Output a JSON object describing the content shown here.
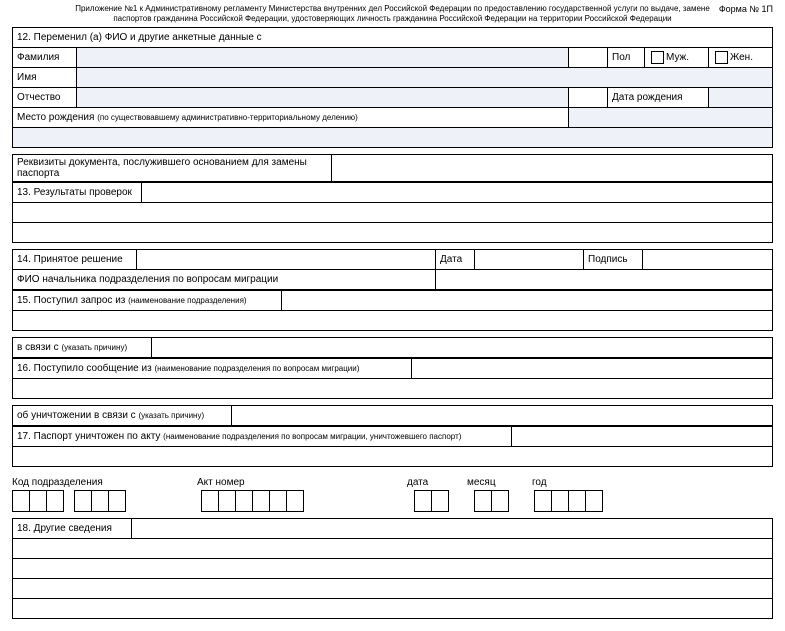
{
  "header": {
    "line1": "Приложение №1 к Административному регламенту Министерства внутренних дел Российской Федерации по предоставлению государственной услуги по выдаче, замене",
    "line2": "паспортов гражданина Российской Федерации, удостоверяющих личность гражданина Российской Федерации на территории Российской Федерации",
    "form_no": "Форма № 1П"
  },
  "s12": {
    "title": "12. Переменил (а) ФИО и другие анкетные данные с",
    "surname": "Фамилия",
    "name": "Имя",
    "patronymic": "Отчество",
    "sex": "Пол",
    "male": "Муж.",
    "female": "Жен.",
    "dob": "Дата рождения",
    "pob": "Место рождения",
    "pob_note": "(по существовавшему административно-территориальному делению)",
    "requisites": "Реквизиты документа, послужившего основанием для замены паспорта"
  },
  "s13": {
    "title": "13. Результаты проверок"
  },
  "s14": {
    "title": "14. Принятое решение",
    "date": "Дата",
    "sign": "Подпись",
    "fio": "ФИО начальника подразделения по вопросам миграции"
  },
  "s15": {
    "title": "15. Поступил запрос из",
    "title_note": "(наименование подразделения)",
    "inrelation": "в связи с",
    "inrelation_note": "(указать причину)"
  },
  "s16": {
    "title": "16. Поступило сообщение из",
    "title_note": "(наименование подразделения по вопросам миграции)",
    "destroy": "об уничтожении в связи с",
    "destroy_note": "(указать причину)"
  },
  "s17": {
    "title": "17. Паспорт уничтожен по акту",
    "title_note": "(наименование подразделения по вопросам миграции, уничтожевшего паспорт)"
  },
  "codes": {
    "dept": "Код подразделения",
    "act": "Акт номер",
    "date": "дата",
    "month": "месяц",
    "year": "год"
  },
  "s18": {
    "title": "18. Другие сведения"
  }
}
